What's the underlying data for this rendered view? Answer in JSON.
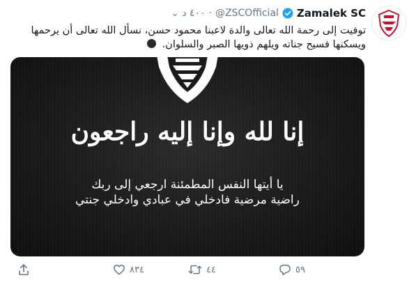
{
  "tweet": {
    "display_name": "Zamalek SC",
    "handle": "@ZSCOfficial",
    "separator": "·",
    "time": "٤٠٠ د",
    "text": "توفيت إلى رحمة الله تعالى والدة لاعبنا محمود حسن، نسأل الله تعالى أن يرحمها ويسكنها فسيح جناته ويلهم ذويها الصبر والسلوان.",
    "emoji": "black-circle-emoji"
  },
  "media": {
    "main_verse": "إنا لله وإنا إليه راجعون",
    "sub_verse_line1": "يا أيتها النفس المطمئنة ارجعي إلى ربك",
    "sub_verse_line2": "راضية مرضية فادخلي في عبادي وادخلي جنتي"
  },
  "actions": {
    "reply_count": "٥٩",
    "retweet_count": "٤٤",
    "like_count": "٨٣٤"
  },
  "colors": {
    "text": "#14171a",
    "muted": "#657786",
    "verified": "#1da1f2",
    "media_bg": "#1b1b1b"
  }
}
